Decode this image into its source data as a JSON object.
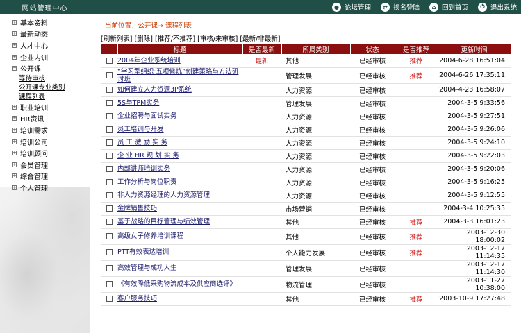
{
  "header": {
    "title": "网站管理中心",
    "nav": [
      {
        "label": "论坛管理",
        "icon": "forum-icon"
      },
      {
        "label": "换名登陆",
        "icon": "switch-user-icon"
      },
      {
        "label": "回到首页",
        "icon": "home-icon"
      },
      {
        "label": "退出系统",
        "icon": "logout-icon"
      }
    ]
  },
  "sidebar": {
    "items": [
      {
        "label": "基本资料",
        "toggle": "+"
      },
      {
        "label": "最新动态",
        "toggle": "+"
      },
      {
        "label": "人才中心",
        "toggle": "+"
      },
      {
        "label": "企业内训",
        "toggle": "+"
      },
      {
        "label": "公开课",
        "toggle": "−",
        "children": [
          "等待审核",
          "公开课专业类别",
          "课程列表"
        ]
      },
      {
        "label": "职业培训",
        "toggle": "+"
      },
      {
        "label": "HR资讯",
        "toggle": "+"
      },
      {
        "label": "培训需求",
        "toggle": "+"
      },
      {
        "label": "培训公司",
        "toggle": "+"
      },
      {
        "label": "培训顾问",
        "toggle": "+"
      },
      {
        "label": "会员管理",
        "toggle": "+"
      },
      {
        "label": "综合管理",
        "toggle": "+"
      },
      {
        "label": "个人管理",
        "toggle": "+"
      }
    ]
  },
  "breadcrumb": "当前位置：公开课→ 课程列表",
  "actions": [
    {
      "label": "刷新列表"
    },
    {
      "label": "删除"
    },
    {
      "label": "推荐/不推荐"
    },
    {
      "label": "审核/未审核"
    },
    {
      "label": "最新/非最新"
    }
  ],
  "table": {
    "headers": [
      "",
      "标题",
      "是否最新",
      "所属类别",
      "状态",
      "是否推荐",
      "更新时间"
    ],
    "rows": [
      {
        "title": "2004年企业系统培训",
        "new": "最新",
        "category": "其他",
        "status": "已经审核",
        "recommend": "推荐",
        "time": "2004-6-28 16:51:04"
      },
      {
        "title": "“学习型组织·五项修炼”创建策略与方法研讨班",
        "new": "",
        "category": "管理发展",
        "status": "已经审核",
        "recommend": "推荐",
        "time": "2004-6-26 17:35:11"
      },
      {
        "title": "如何建立人力资源3P系统",
        "new": "",
        "category": "人力资源",
        "status": "已经审核",
        "recommend": "",
        "time": "2004-4-23 16:58:07"
      },
      {
        "title": "5S与TPM实务",
        "new": "",
        "category": "管理发展",
        "status": "已经审核",
        "recommend": "",
        "time": "2004-3-5 9:33:56"
      },
      {
        "title": "企业招聘与面试实务",
        "new": "",
        "category": "人力资源",
        "status": "已经审核",
        "recommend": "",
        "time": "2004-3-5 9:27:51"
      },
      {
        "title": "员工培训与开发",
        "new": "",
        "category": "人力资源",
        "status": "已经审核",
        "recommend": "",
        "time": "2004-3-5 9:26:06"
      },
      {
        "title": "员 工 激 励 实 务",
        "new": "",
        "category": "人力资源",
        "status": "已经审核",
        "recommend": "",
        "time": "2004-3-5 9:24:10"
      },
      {
        "title": "企 业 HR 规 划 实 务",
        "new": "",
        "category": "人力资源",
        "status": "已经审核",
        "recommend": "",
        "time": "2004-3-5 9:22:03"
      },
      {
        "title": "内部讲师培训实务",
        "new": "",
        "category": "人力资源",
        "status": "已经审核",
        "recommend": "",
        "time": "2004-3-5 9:20:06"
      },
      {
        "title": "工作分析与岗位职责",
        "new": "",
        "category": "人力资源",
        "status": "已经审核",
        "recommend": "",
        "time": "2004-3-5 9:16:25"
      },
      {
        "title": "非人力资源经理的人力资源管理",
        "new": "",
        "category": "人力资源",
        "status": "已经审核",
        "recommend": "",
        "time": "2004-3-5 9:12:55"
      },
      {
        "title": "金牌销售技巧",
        "new": "",
        "category": "市场营销",
        "status": "已经审核",
        "recommend": "",
        "time": "2004-3-4 10:25:35"
      },
      {
        "title": "基于战略的目标管理与绩效管理",
        "new": "",
        "category": "其他",
        "status": "已经审核",
        "recommend": "推荐",
        "time": "2004-3-3 16:01:23"
      },
      {
        "title": "高级女子修养培训课程",
        "new": "",
        "category": "其他",
        "status": "已经审核",
        "recommend": "推荐",
        "time": "2003-12-30 18:00:02"
      },
      {
        "title": "PTT有效表达培训",
        "new": "",
        "category": "个人能力发展",
        "status": "已经审核",
        "recommend": "推荐",
        "time": "2003-12-17 11:14:35"
      },
      {
        "title": "高效管理与成功人生",
        "new": "",
        "category": "管理发展",
        "status": "已经审核",
        "recommend": "",
        "time": "2003-12-17 11:14:30"
      },
      {
        "title": "《有效降低采购物流成本及供应商选评》",
        "new": "",
        "category": "物流管理",
        "status": "已经审核",
        "recommend": "",
        "time": "2003-11-27 10:38:00"
      },
      {
        "title": "客户服务技巧",
        "new": "",
        "category": "其他",
        "status": "已经审核",
        "recommend": "推荐",
        "time": "2003-10-9 17:27:48"
      }
    ]
  },
  "colors": {
    "topbar": "#1f4f47",
    "table_header": "#8c0f0f",
    "accent_red": "#d21414",
    "breadcrumb": "#c83c00",
    "link": "#1a1a6a"
  }
}
